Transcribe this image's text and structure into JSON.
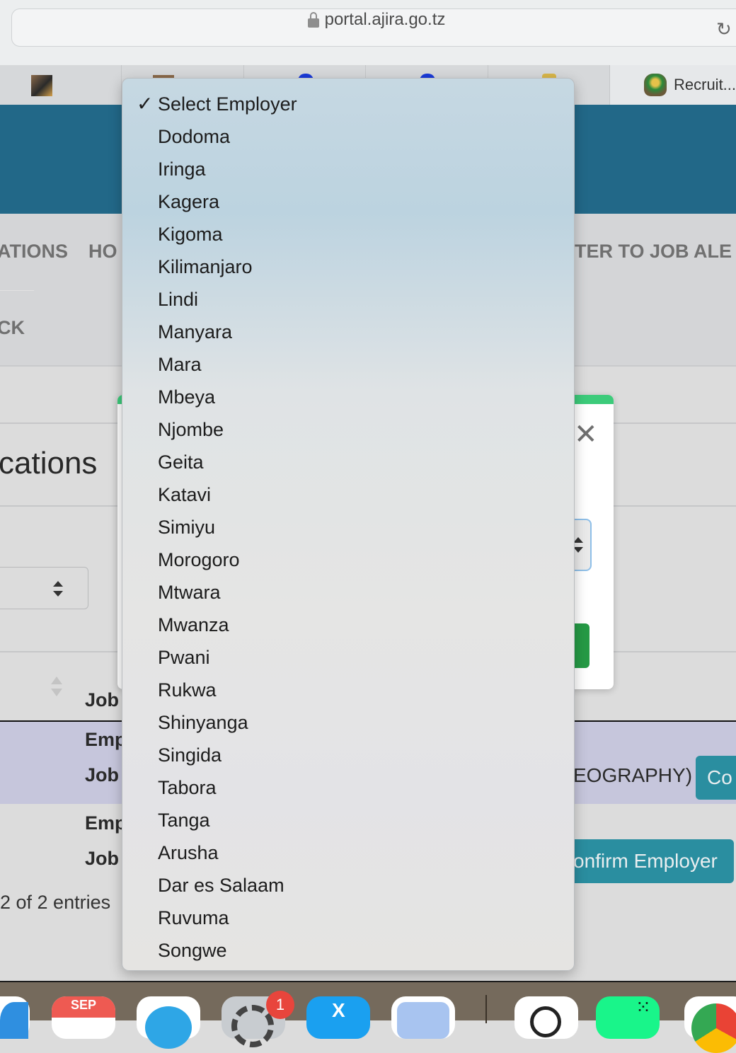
{
  "browser": {
    "url": "portal.ajira.go.tz",
    "tabs": [
      {
        "label": "",
        "icon": "photo-favicon"
      },
      {
        "label": "",
        "icon": "photo-favicon"
      },
      {
        "label": "",
        "icon": "blue-favicon"
      },
      {
        "label": "",
        "icon": "blue-favicon"
      },
      {
        "label": "",
        "icon": "crest-favicon"
      },
      {
        "label": "Recruit...",
        "icon": "tanzania-crest-icon",
        "active": true
      }
    ]
  },
  "nav": {
    "items": [
      "ATIONS",
      "HO",
      "TER TO JOB ALE",
      "CK"
    ]
  },
  "page": {
    "heading": "cations",
    "table": {
      "header": "Job",
      "rows": [
        {
          "label1": "Emp",
          "label2": "Job",
          "text": "EOGRAPHY)",
          "button": "Co"
        },
        {
          "label1": "Emp",
          "label2": "Job",
          "button": "onfirm Employer"
        }
      ]
    },
    "entries_info": "2 of 2 entries"
  },
  "dropdown": {
    "selected": "Select Employer",
    "options": [
      "Select Employer",
      "Dodoma",
      "Iringa",
      "Kagera",
      "Kigoma",
      "Kilimanjaro",
      "Lindi",
      "Manyara",
      "Mara",
      "Mbeya",
      "Njombe",
      "Geita",
      "Katavi",
      "Simiyu",
      "Morogoro",
      "Mtwara",
      "Mwanza",
      "Pwani",
      "Rukwa",
      "Shinyanga",
      "Singida",
      "Tabora",
      "Tanga",
      "Arusha",
      "Dar es Salaam",
      "Ruvuma",
      "Songwe"
    ]
  },
  "dock": {
    "calendar_month": "SEP",
    "settings_badge": "1"
  },
  "colors": {
    "hero": "#226888",
    "confirm_button": "#2a8ea0",
    "modal_accent": "#3ccb7a",
    "modal_button": "#259a45",
    "row_highlight": "#c6c6dc"
  }
}
